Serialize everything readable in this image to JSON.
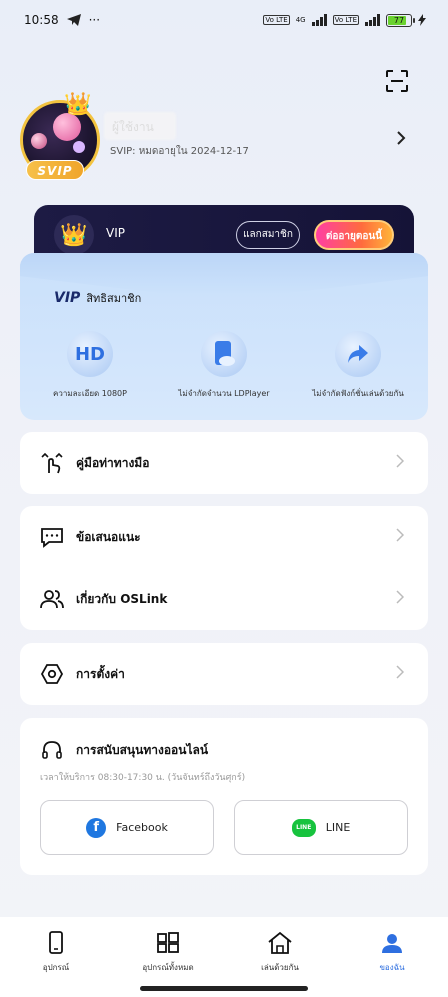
{
  "status_bar": {
    "time": "10:58",
    "more": "···",
    "battery_level": "77",
    "volte": "Vo LTE",
    "network": "4G"
  },
  "profile": {
    "username": "ผู้ใช้งาน",
    "badge": "SVIP",
    "expiry": "SVIP: หมดอายุใน 2024-12-17"
  },
  "vip": {
    "label": "VIP",
    "redeem_label": "แลกสมาชิก",
    "renew_label": "ต่ออายุตอนนี้",
    "benefits_mark": "VIP",
    "benefits_title": "สิทธิสมาชิก",
    "benefits": [
      {
        "icon_text": "HD",
        "label": "ความละเอียด 1080P"
      },
      {
        "icon_text": "",
        "label": "ไม่จำกัดจำนวน LDPlayer"
      },
      {
        "icon_text": "",
        "label": "ไม่จำกัดฟังก์ชั่นเล่นด้วยกัน"
      }
    ]
  },
  "menu": {
    "guide": "คู่มือท่าทางมือ",
    "feedback": "ข้อเสนอแนะ",
    "about": "เกี่ยวกับ OSLink",
    "settings": "การตั้งค่า"
  },
  "support": {
    "title": "การสนับสนุนทางออนไลน์",
    "hours": "เวลาให้บริการ 08:30-17:30 น. (วันจันทร์ถึงวันศุกร์)",
    "facebook_label": "Facebook",
    "line_label": "LINE",
    "line_icon_text": "LINE",
    "facebook_icon_text": "f"
  },
  "nav": {
    "items": [
      {
        "label": "อุปกรณ์",
        "icon": "phone-icon"
      },
      {
        "label": "อุปกรณ์ทั้งหมด",
        "icon": "grid-icon"
      },
      {
        "label": "เล่นด้วยกัน",
        "icon": "home-icon"
      },
      {
        "label": "ของฉัน",
        "icon": "user-icon"
      }
    ],
    "active_index": 3
  },
  "colors": {
    "accent": "#2e6fe0",
    "vip_dark": "#1d1b44",
    "renew_gradient_start": "#ff3fa4",
    "svip_gold": "#f6c04a"
  }
}
